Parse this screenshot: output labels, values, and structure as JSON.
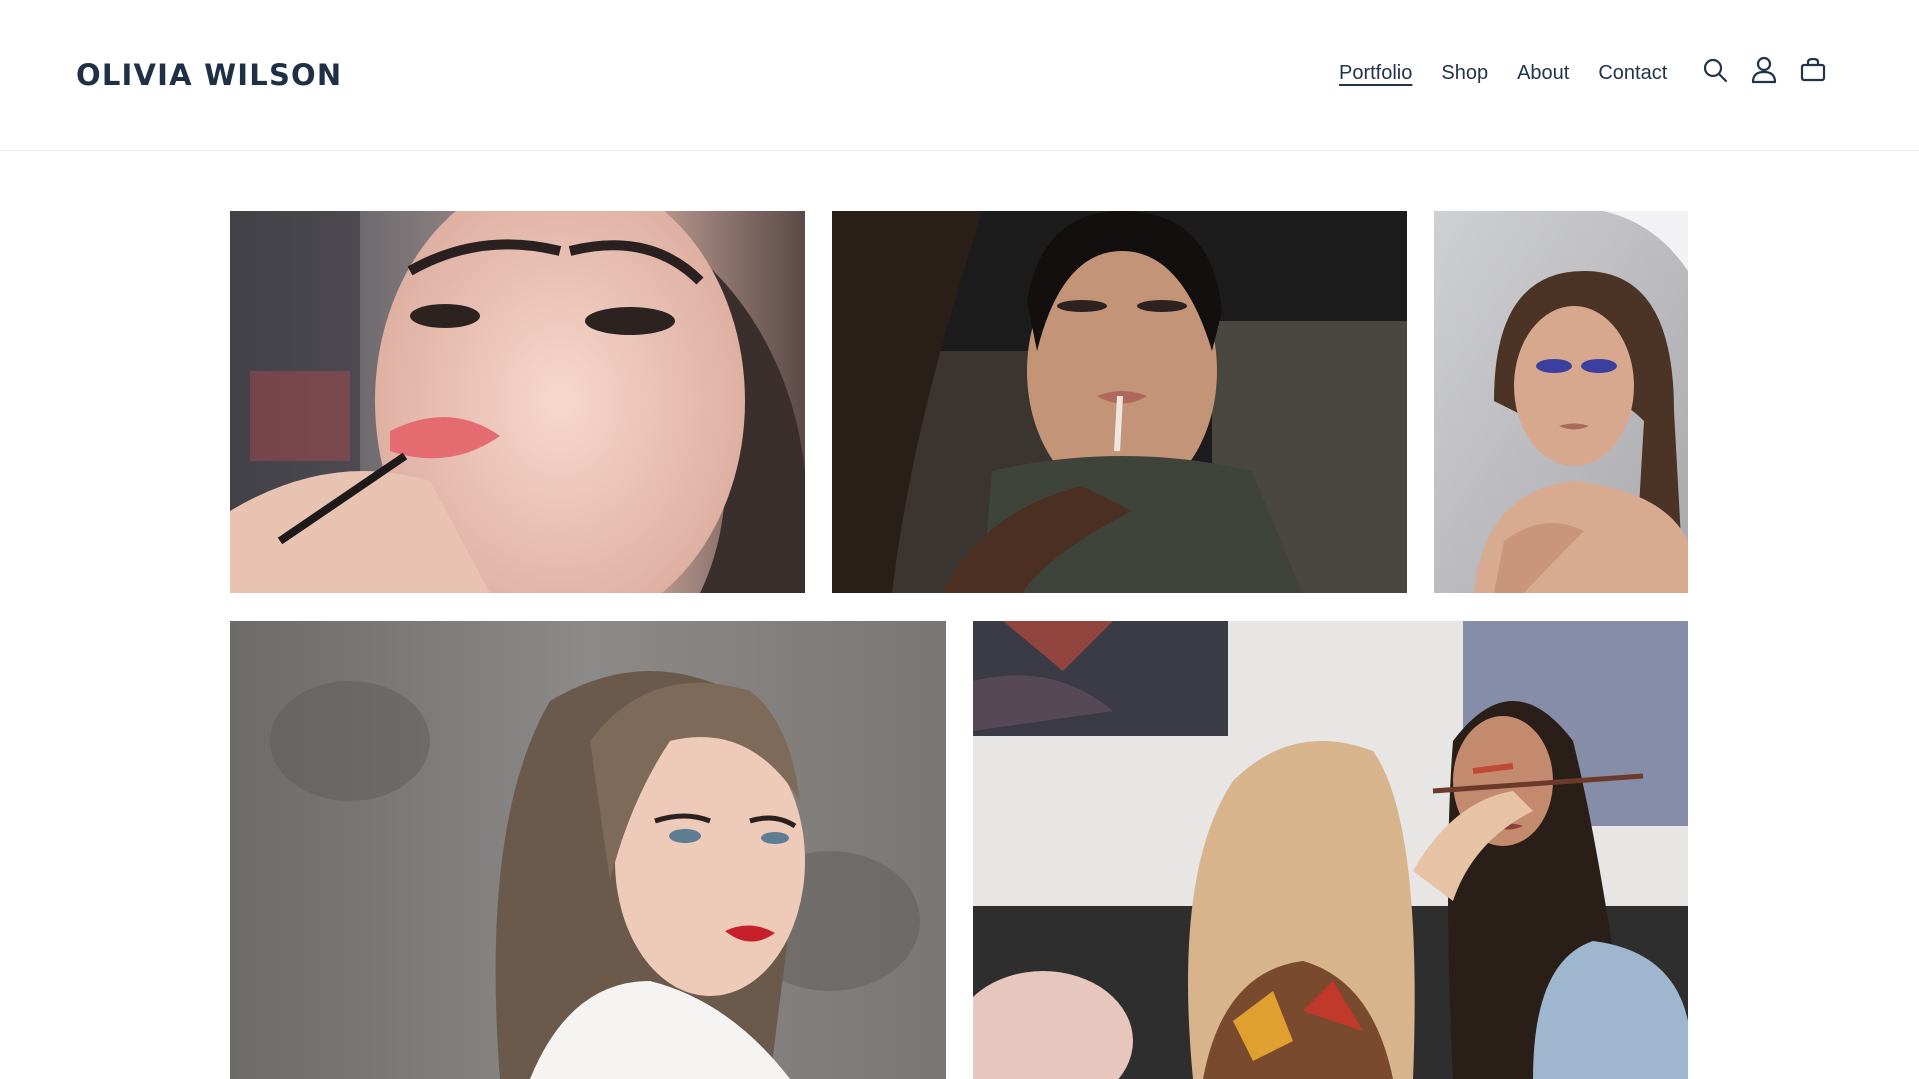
{
  "brand": {
    "name": "OLIVIA WILSON"
  },
  "nav": {
    "items": [
      {
        "label": "Portfolio",
        "active": true
      },
      {
        "label": "Shop",
        "active": false
      },
      {
        "label": "About",
        "active": false
      },
      {
        "label": "Contact",
        "active": false
      }
    ]
  },
  "header_icons": [
    "search-icon",
    "account-icon",
    "cart-icon"
  ],
  "colors": {
    "brand_text": "#1f3046",
    "nav_text": "#223449",
    "background": "#ffffff"
  },
  "gallery": {
    "photos": [
      {
        "name": "photo-lipstick-closeup"
      },
      {
        "name": "photo-lipgloss-application"
      },
      {
        "name": "photo-blue-eyeshadow-portrait"
      },
      {
        "name": "photo-red-lips-bride"
      },
      {
        "name": "photo-eyeshadow-application"
      }
    ]
  }
}
